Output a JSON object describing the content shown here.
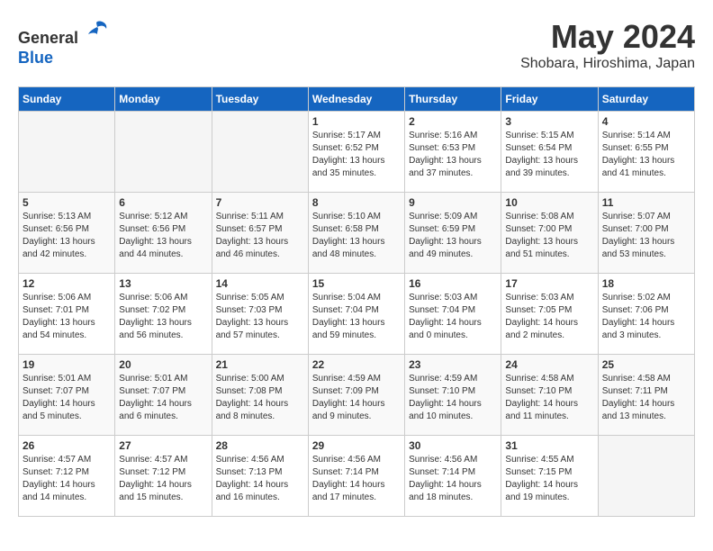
{
  "header": {
    "logo_line1": "General",
    "logo_line2": "Blue",
    "month_title": "May 2024",
    "location": "Shobara, Hiroshima, Japan"
  },
  "weekdays": [
    "Sunday",
    "Monday",
    "Tuesday",
    "Wednesday",
    "Thursday",
    "Friday",
    "Saturday"
  ],
  "weeks": [
    [
      {
        "day": "",
        "info": ""
      },
      {
        "day": "",
        "info": ""
      },
      {
        "day": "",
        "info": ""
      },
      {
        "day": "1",
        "info": "Sunrise: 5:17 AM\nSunset: 6:52 PM\nDaylight: 13 hours\nand 35 minutes."
      },
      {
        "day": "2",
        "info": "Sunrise: 5:16 AM\nSunset: 6:53 PM\nDaylight: 13 hours\nand 37 minutes."
      },
      {
        "day": "3",
        "info": "Sunrise: 5:15 AM\nSunset: 6:54 PM\nDaylight: 13 hours\nand 39 minutes."
      },
      {
        "day": "4",
        "info": "Sunrise: 5:14 AM\nSunset: 6:55 PM\nDaylight: 13 hours\nand 41 minutes."
      }
    ],
    [
      {
        "day": "5",
        "info": "Sunrise: 5:13 AM\nSunset: 6:56 PM\nDaylight: 13 hours\nand 42 minutes."
      },
      {
        "day": "6",
        "info": "Sunrise: 5:12 AM\nSunset: 6:56 PM\nDaylight: 13 hours\nand 44 minutes."
      },
      {
        "day": "7",
        "info": "Sunrise: 5:11 AM\nSunset: 6:57 PM\nDaylight: 13 hours\nand 46 minutes."
      },
      {
        "day": "8",
        "info": "Sunrise: 5:10 AM\nSunset: 6:58 PM\nDaylight: 13 hours\nand 48 minutes."
      },
      {
        "day": "9",
        "info": "Sunrise: 5:09 AM\nSunset: 6:59 PM\nDaylight: 13 hours\nand 49 minutes."
      },
      {
        "day": "10",
        "info": "Sunrise: 5:08 AM\nSunset: 7:00 PM\nDaylight: 13 hours\nand 51 minutes."
      },
      {
        "day": "11",
        "info": "Sunrise: 5:07 AM\nSunset: 7:00 PM\nDaylight: 13 hours\nand 53 minutes."
      }
    ],
    [
      {
        "day": "12",
        "info": "Sunrise: 5:06 AM\nSunset: 7:01 PM\nDaylight: 13 hours\nand 54 minutes."
      },
      {
        "day": "13",
        "info": "Sunrise: 5:06 AM\nSunset: 7:02 PM\nDaylight: 13 hours\nand 56 minutes."
      },
      {
        "day": "14",
        "info": "Sunrise: 5:05 AM\nSunset: 7:03 PM\nDaylight: 13 hours\nand 57 minutes."
      },
      {
        "day": "15",
        "info": "Sunrise: 5:04 AM\nSunset: 7:04 PM\nDaylight: 13 hours\nand 59 minutes."
      },
      {
        "day": "16",
        "info": "Sunrise: 5:03 AM\nSunset: 7:04 PM\nDaylight: 14 hours\nand 0 minutes."
      },
      {
        "day": "17",
        "info": "Sunrise: 5:03 AM\nSunset: 7:05 PM\nDaylight: 14 hours\nand 2 minutes."
      },
      {
        "day": "18",
        "info": "Sunrise: 5:02 AM\nSunset: 7:06 PM\nDaylight: 14 hours\nand 3 minutes."
      }
    ],
    [
      {
        "day": "19",
        "info": "Sunrise: 5:01 AM\nSunset: 7:07 PM\nDaylight: 14 hours\nand 5 minutes."
      },
      {
        "day": "20",
        "info": "Sunrise: 5:01 AM\nSunset: 7:07 PM\nDaylight: 14 hours\nand 6 minutes."
      },
      {
        "day": "21",
        "info": "Sunrise: 5:00 AM\nSunset: 7:08 PM\nDaylight: 14 hours\nand 8 minutes."
      },
      {
        "day": "22",
        "info": "Sunrise: 4:59 AM\nSunset: 7:09 PM\nDaylight: 14 hours\nand 9 minutes."
      },
      {
        "day": "23",
        "info": "Sunrise: 4:59 AM\nSunset: 7:10 PM\nDaylight: 14 hours\nand 10 minutes."
      },
      {
        "day": "24",
        "info": "Sunrise: 4:58 AM\nSunset: 7:10 PM\nDaylight: 14 hours\nand 11 minutes."
      },
      {
        "day": "25",
        "info": "Sunrise: 4:58 AM\nSunset: 7:11 PM\nDaylight: 14 hours\nand 13 minutes."
      }
    ],
    [
      {
        "day": "26",
        "info": "Sunrise: 4:57 AM\nSunset: 7:12 PM\nDaylight: 14 hours\nand 14 minutes."
      },
      {
        "day": "27",
        "info": "Sunrise: 4:57 AM\nSunset: 7:12 PM\nDaylight: 14 hours\nand 15 minutes."
      },
      {
        "day": "28",
        "info": "Sunrise: 4:56 AM\nSunset: 7:13 PM\nDaylight: 14 hours\nand 16 minutes."
      },
      {
        "day": "29",
        "info": "Sunrise: 4:56 AM\nSunset: 7:14 PM\nDaylight: 14 hours\nand 17 minutes."
      },
      {
        "day": "30",
        "info": "Sunrise: 4:56 AM\nSunset: 7:14 PM\nDaylight: 14 hours\nand 18 minutes."
      },
      {
        "day": "31",
        "info": "Sunrise: 4:55 AM\nSunset: 7:15 PM\nDaylight: 14 hours\nand 19 minutes."
      },
      {
        "day": "",
        "info": ""
      }
    ]
  ]
}
